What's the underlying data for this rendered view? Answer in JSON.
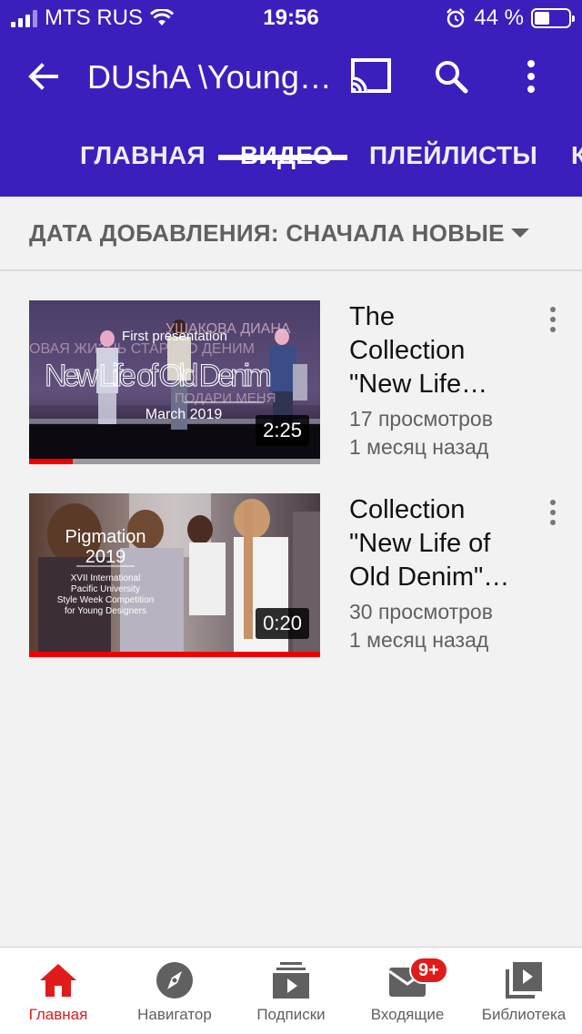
{
  "status_bar": {
    "carrier": "MTS RUS",
    "time": "19:56",
    "battery": "44 %"
  },
  "header": {
    "title": "DUshA \\Young…",
    "tabs": [
      {
        "label": "ГЛАВНАЯ"
      },
      {
        "label": "ВИДЕО"
      },
      {
        "label": "ПЛЕЙЛИСТЫ"
      },
      {
        "label": "К"
      }
    ],
    "active_tab": "ВИДЕО"
  },
  "sort": {
    "label": "ДАТА ДОБАВЛЕНИЯ: СНАЧАЛА НОВЫЕ"
  },
  "videos": [
    {
      "title_lines": [
        "The",
        "Collection",
        "\"New Life…"
      ],
      "views": "17 просмотров",
      "age": "1 месяц назад",
      "duration": "2:25",
      "watched_fraction": 0.15,
      "thumbnail": {
        "overlay_lines": [
          "First presentation",
          "New Life of Old Denim",
          "March 2019"
        ],
        "background_text": [
          "УШАКОВА ДИАНА",
          "ОВАЯ ЖИЗНЬ СТАРОГО ДЕНИМ",
          "ПОДАРИ МЕНЯ"
        ]
      }
    },
    {
      "title_lines": [
        "Collection",
        "\"New Life of",
        "Old Denim\"…"
      ],
      "views": "30 просмотров",
      "age": "1 месяц назад",
      "duration": "0:20",
      "watched_fraction": 1.0,
      "thumbnail": {
        "overlay_lines": [
          "Pigmation",
          "2019",
          "XVII International",
          "Pacific University",
          "Style Week Competition",
          "for Young Designers"
        ]
      }
    }
  ],
  "bottom_nav": [
    {
      "label": "Главная",
      "icon": "home-icon",
      "active": true
    },
    {
      "label": "Навигатор",
      "icon": "compass-icon"
    },
    {
      "label": "Подписки",
      "icon": "subscriptions-icon"
    },
    {
      "label": "Входящие",
      "icon": "inbox-icon",
      "badge": "9+"
    },
    {
      "label": "Библиотека",
      "icon": "library-icon"
    }
  ],
  "colors": {
    "header_bg": "#3b1fbd",
    "accent_red": "#e01b1b"
  }
}
